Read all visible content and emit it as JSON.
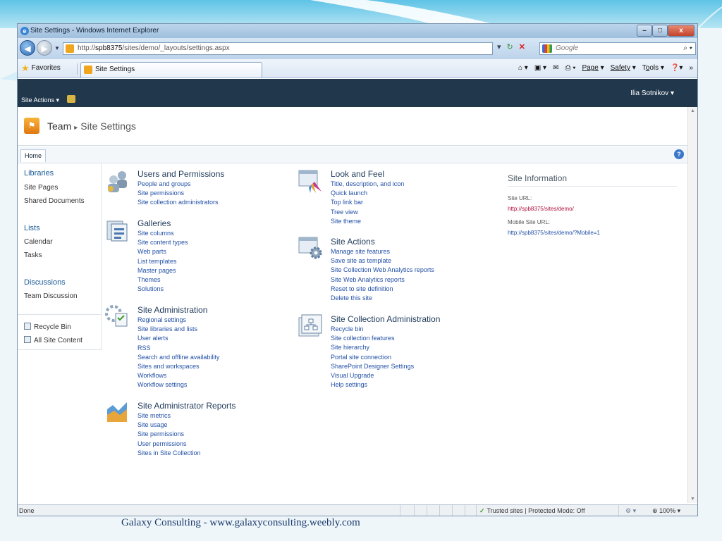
{
  "browser": {
    "window_title": "Site Settings - Windows Internet Explorer",
    "url_prefix": "http://",
    "url_host": "spb8375",
    "url_path": "/sites/demo/_layouts/settings.aspx",
    "search_placeholder": "Google",
    "favorites_label": "Favorites",
    "tab_title": "Site Settings",
    "commands": {
      "page": "Page",
      "safety": "Safety",
      "tools_pre": "T",
      "tools_u": "o",
      "tools_post": "ols"
    },
    "status_text": "Done",
    "zone_text": "Trusted sites | Protected Mode: Off",
    "zoom": "100%"
  },
  "sharepoint": {
    "site_actions": "Site Actions",
    "user_name": "Ilia Sotnikov",
    "breadcrumb_site": "Team",
    "breadcrumb_page": "Site Settings",
    "top_nav_home": "Home",
    "left_nav": {
      "libraries": "Libraries",
      "site_pages": "Site Pages",
      "shared_documents": "Shared Documents",
      "lists": "Lists",
      "calendar": "Calendar",
      "tasks": "Tasks",
      "discussions": "Discussions",
      "team_discussion": "Team Discussion",
      "recycle_bin": "Recycle Bin",
      "all_site_content": "All Site Content"
    },
    "sections": [
      {
        "title": "Users and Permissions",
        "links": [
          "People and groups",
          "Site permissions",
          "Site collection administrators"
        ]
      },
      {
        "title": "Galleries",
        "links": [
          "Site columns",
          "Site content types",
          "Web parts",
          "List templates",
          "Master pages",
          "Themes",
          "Solutions"
        ]
      },
      {
        "title": "Site Administration",
        "links": [
          "Regional settings",
          "Site libraries and lists",
          "User alerts",
          "RSS",
          "Search and offline availability",
          "Sites and workspaces",
          "Workflows",
          "Workflow settings"
        ]
      },
      {
        "title": "Site Administrator Reports",
        "links": [
          "Site metrics",
          "Site usage",
          "Site permissions",
          "User permissions",
          "Sites in Site Collection"
        ]
      },
      {
        "title": "Look and Feel",
        "links": [
          "Title, description, and icon",
          "Quick launch",
          "Top link bar",
          "Tree view",
          "Site theme"
        ]
      },
      {
        "title": "Site Actions",
        "links": [
          "Manage site features",
          "Save site as template",
          "Site Collection Web Analytics reports",
          "Site Web Analytics reports",
          "Reset to site definition",
          "Delete this site"
        ]
      },
      {
        "title": "Site Collection Administration",
        "links": [
          "Recycle bin",
          "Site collection features",
          "Site hierarchy",
          "Portal site connection",
          "SharePoint Designer Settings",
          "Visual Upgrade",
          "Help settings"
        ]
      }
    ],
    "site_info": {
      "title": "Site Information",
      "site_url_label": "Site URL:",
      "site_url": "http://spb8375/sites/demo/",
      "mobile_url_label": "Mobile Site URL:",
      "mobile_url": "http://spb8375/sites/demo/?Mobile=1"
    }
  },
  "footer": "Galaxy Consulting - www.galaxyconsulting.weebly.com"
}
